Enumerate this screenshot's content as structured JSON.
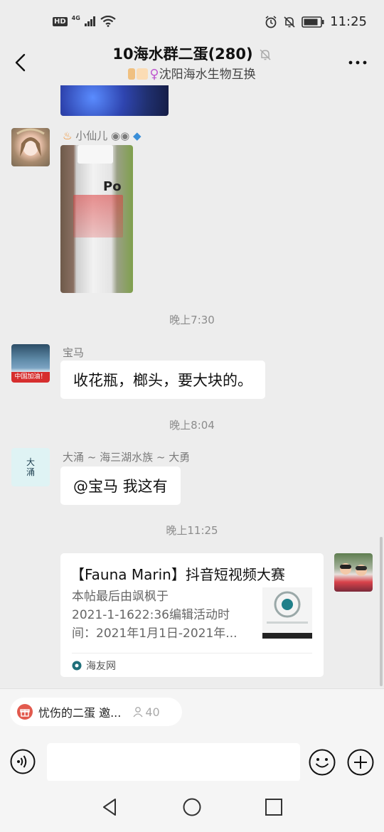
{
  "status_bar": {
    "hd": "HD",
    "network": "4G",
    "time": "11:25"
  },
  "header": {
    "title": "10海水群二蛋(280)",
    "subtitle": "沈阳海水生物互换"
  },
  "messages": {
    "msg1": {
      "sender": "小仙儿",
      "photo_text": "Po"
    },
    "time1": "晚上7:30",
    "msg2": {
      "sender": "宝马",
      "avatar_badge": "中国加油！",
      "text": "收花瓶，榔头，要大块的。"
    },
    "time2": "晚上8:04",
    "msg3": {
      "sender": "大涌 ~ 海三湖水族 ~ 大勇",
      "avatar_text": "大\n涌",
      "text": "@宝马  我这有"
    },
    "time3": "晚上11:25",
    "card": {
      "title": "【Fauna Marin】抖音短视频大赛",
      "desc_lines": [
        "本帖最后由飒枫于",
        "2021-1-1622:36编辑活动时",
        "间：2021年1月1日-2021年..."
      ],
      "source": "海友网"
    }
  },
  "bottom": {
    "invite_text": "忧伤的二蛋 邀...",
    "invite_count": "40",
    "input_placeholder": ""
  },
  "colors": {
    "background": "#ededed",
    "bubble": "#ffffff",
    "invite_icon": "#e25a4e"
  },
  "icons": [
    "back-icon",
    "mute-bell-icon",
    "more-icon",
    "voice-icon",
    "emoji-icon",
    "plus-icon",
    "nav-back-icon",
    "nav-home-icon",
    "nav-recent-icon",
    "alarm-icon",
    "bell-off-icon",
    "battery-icon",
    "wifi-icon",
    "signal-icon"
  ]
}
